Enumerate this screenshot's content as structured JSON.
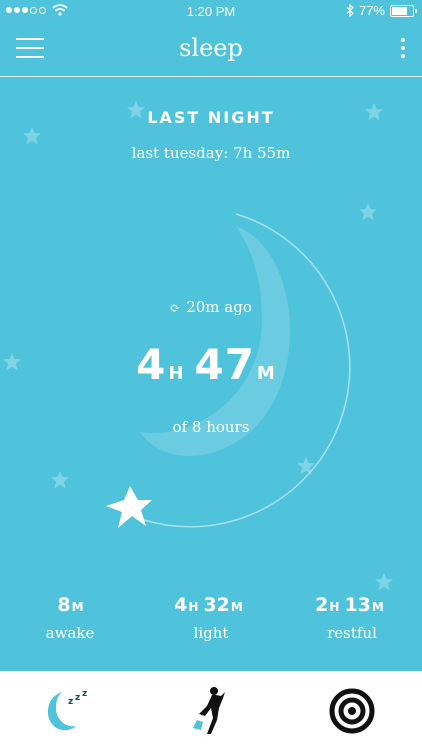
{
  "status_bar": {
    "time": "1:20 PM",
    "battery": "77%",
    "battery_level": 0.77
  },
  "nav": {
    "title": "sleep",
    "menu_icon": "hamburger-menu-icon",
    "more_icon": "vertical-ellipsis-icon"
  },
  "summary": {
    "heading": "LAST NIGHT",
    "comparison": "last tuesday: 7h 55m",
    "synced": "20m ago",
    "duration_hours": "4",
    "duration_hours_unit": "H",
    "duration_minutes": "47",
    "duration_minutes_unit": "M",
    "goal": "of 8 hours",
    "progress": 0.6
  },
  "stats": [
    {
      "hours": "",
      "hours_unit": "",
      "minutes": "8",
      "minutes_unit": "M",
      "label": "awake"
    },
    {
      "hours": "4",
      "hours_unit": "H",
      "minutes": "32",
      "minutes_unit": "M",
      "label": "light"
    },
    {
      "hours": "2",
      "hours_unit": "H",
      "minutes": "13",
      "minutes_unit": "M",
      "label": "restful"
    }
  ],
  "tabs": [
    {
      "icon": "sleep-moon-icon"
    },
    {
      "icon": "activity-figure-icon"
    },
    {
      "icon": "target-rings-icon"
    }
  ],
  "colors": {
    "background": "#4fc3dc",
    "accent_dark": "#4bbcd6",
    "tabbar": "#ffffff"
  }
}
